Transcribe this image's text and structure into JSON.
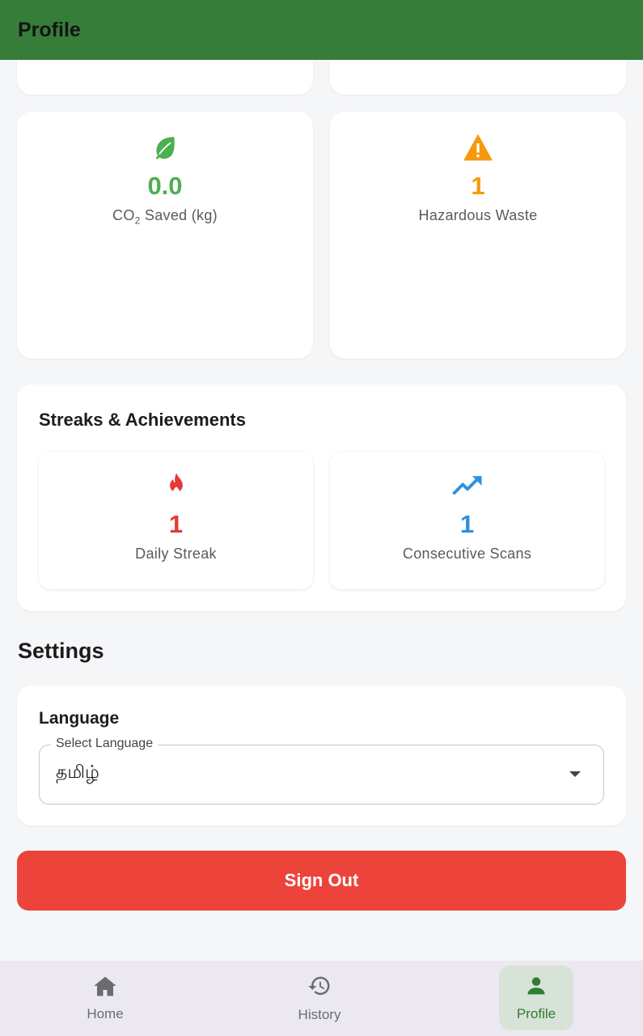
{
  "appbar": {
    "title": "Profile"
  },
  "stats": {
    "co2": {
      "value": "0.0",
      "label_prefix": "CO",
      "label_sub": "2",
      "label_suffix": " Saved (kg)",
      "color": "#4caf50",
      "icon": "leaf-icon"
    },
    "hazardous": {
      "value": "1",
      "label": "Hazardous Waste",
      "color": "#f59a0c",
      "icon": "warning-icon"
    }
  },
  "streaks": {
    "title": "Streaks & Achievements",
    "daily": {
      "value": "1",
      "label": "Daily Streak",
      "color": "#e53935",
      "icon": "fire-icon"
    },
    "consecutive": {
      "value": "1",
      "label": "Consecutive Scans",
      "color": "#2f8fe0",
      "icon": "trending-up-icon"
    }
  },
  "settings": {
    "heading": "Settings",
    "language": {
      "title": "Language",
      "field_label": "Select Language",
      "selected": "தமிழ்"
    }
  },
  "signout": {
    "label": "Sign Out",
    "color": "#ec443b"
  },
  "bottom_nav": {
    "items": [
      {
        "label": "Home",
        "icon": "home-icon"
      },
      {
        "label": "History",
        "icon": "history-icon"
      },
      {
        "label": "Profile",
        "icon": "person-icon",
        "active": true
      }
    ]
  }
}
